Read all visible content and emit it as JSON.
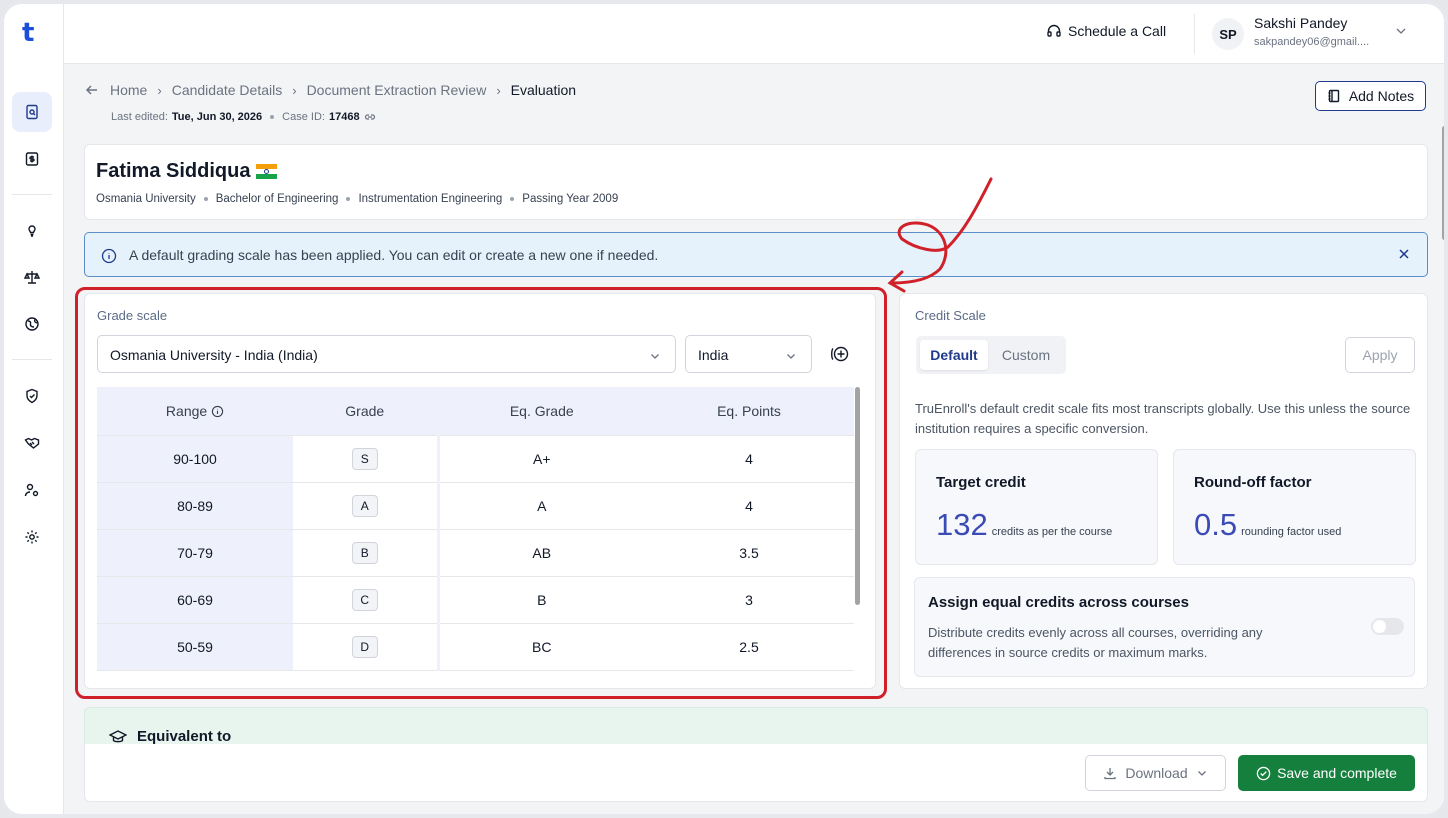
{
  "brand": {
    "logo": "t"
  },
  "topbar": {
    "schedule_label": "Schedule a Call",
    "user_initials": "SP",
    "user_name": "Sakshi Pandey",
    "user_email": "sakpandey06@gmail...."
  },
  "breadcrumb": {
    "items": [
      "Home",
      "Candidate Details",
      "Document Extraction Review"
    ],
    "current": "Evaluation"
  },
  "meta": {
    "last_edited_label": "Last edited:",
    "last_edited": "Tue, Jun 30, 2026",
    "case_label": "Case ID:",
    "case_id": "17468"
  },
  "add_notes_label": "Add Notes",
  "candidate": {
    "name": "Fatima Siddiqua",
    "university": "Osmania University",
    "degree": "Bachelor of Engineering",
    "major": "Instrumentation Engineering",
    "passing_year": "Passing Year 2009"
  },
  "alert": {
    "text": "A default grading scale has been applied. You can edit or create a new one if needed."
  },
  "grade_scale": {
    "label": "Grade scale",
    "scale_select": "Osmania University - India (India)",
    "country_select": "India",
    "columns": [
      "Range",
      "Grade",
      "Eq. Grade",
      "Eq. Points"
    ],
    "rows": [
      {
        "range": "90-100",
        "grade": "S",
        "eq_grade": "A+",
        "eq_points": "4"
      },
      {
        "range": "80-89",
        "grade": "A",
        "eq_grade": "A",
        "eq_points": "4"
      },
      {
        "range": "70-79",
        "grade": "B",
        "eq_grade": "AB",
        "eq_points": "3.5"
      },
      {
        "range": "60-69",
        "grade": "C",
        "eq_grade": "B",
        "eq_points": "3"
      },
      {
        "range": "50-59",
        "grade": "D",
        "eq_grade": "BC",
        "eq_points": "2.5"
      }
    ]
  },
  "credit_scale": {
    "label": "Credit Scale",
    "tab_default": "Default",
    "tab_custom": "Custom",
    "apply_label": "Apply",
    "description": "TruEnroll's default credit scale fits most transcripts globally. Use this unless the source institution requires a specific conversion.",
    "target_title": "Target credit",
    "target_value": "132",
    "target_caption": "credits as per the course",
    "round_title": "Round-off factor",
    "round_value": "0.5",
    "round_caption": "rounding factor used",
    "equal_title": "Assign equal credits across courses",
    "equal_desc": "Distribute credits evenly across all courses, overriding any differences in source credits or maximum marks.",
    "equal_enabled": false
  },
  "equivalent_label": "Equivalent to",
  "footer": {
    "download_label": "Download",
    "save_label": "Save and complete"
  },
  "colors": {
    "accent": "#1e3a8a",
    "save": "#15803d",
    "annotation": "#d0202a",
    "stat_number": "#3b4bb5"
  }
}
